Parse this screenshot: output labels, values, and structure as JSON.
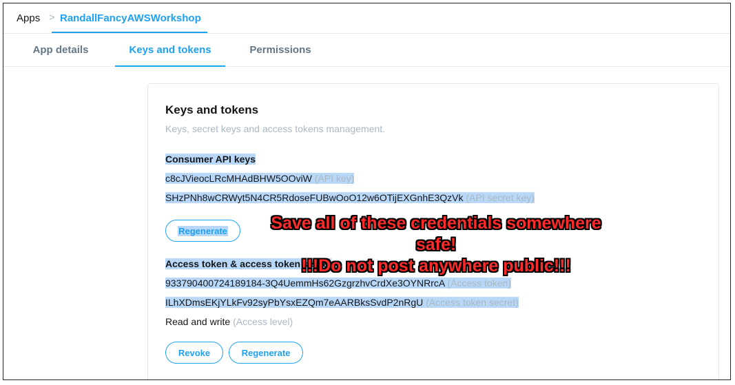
{
  "breadcrumb": {
    "root": "Apps",
    "separator": ">",
    "current": "RandallFancyAWSWorkshop"
  },
  "tabs": [
    {
      "label": "App details",
      "active": false
    },
    {
      "label": "Keys and tokens",
      "active": true
    },
    {
      "label": "Permissions",
      "active": false
    }
  ],
  "card": {
    "title": "Keys and tokens",
    "subtitle": "Keys, secret keys and access tokens management.",
    "consumer": {
      "heading": "Consumer API keys",
      "api_key": "c8cJVieocLRcMHAdBHW5OOviW",
      "api_key_label": "(API key)",
      "api_secret": "SHzPNh8wCRWyt5N4CR5RdoseFUBwOoO12w6OTijEXGnhE3QzVk",
      "api_secret_label": "(API secret key)",
      "regenerate_label": "Regenerate"
    },
    "access": {
      "heading": "Access token & access token secret",
      "token": "933790400724189184-3Q4UemmHs62GzgrzhvCrdXe3OYNRrcA",
      "token_label": "(Access token)",
      "secret": "ILhXDmsEKjYLkFv92syPbYsxEZQm7eAARBksSvdP2nRgU",
      "secret_label": "(Access token secret)",
      "level": "Read and write",
      "level_label": "(Access level)",
      "revoke_label": "Revoke",
      "regenerate_label": "Regenerate"
    }
  },
  "warning": {
    "line1": "Save all of these credentials somewhere safe!",
    "line2": "!!!Do not post anywhere public!!!"
  },
  "colors": {
    "accent": "#1da1f2",
    "selection": "#b9d8f8",
    "warning": "#ff2a2a"
  }
}
